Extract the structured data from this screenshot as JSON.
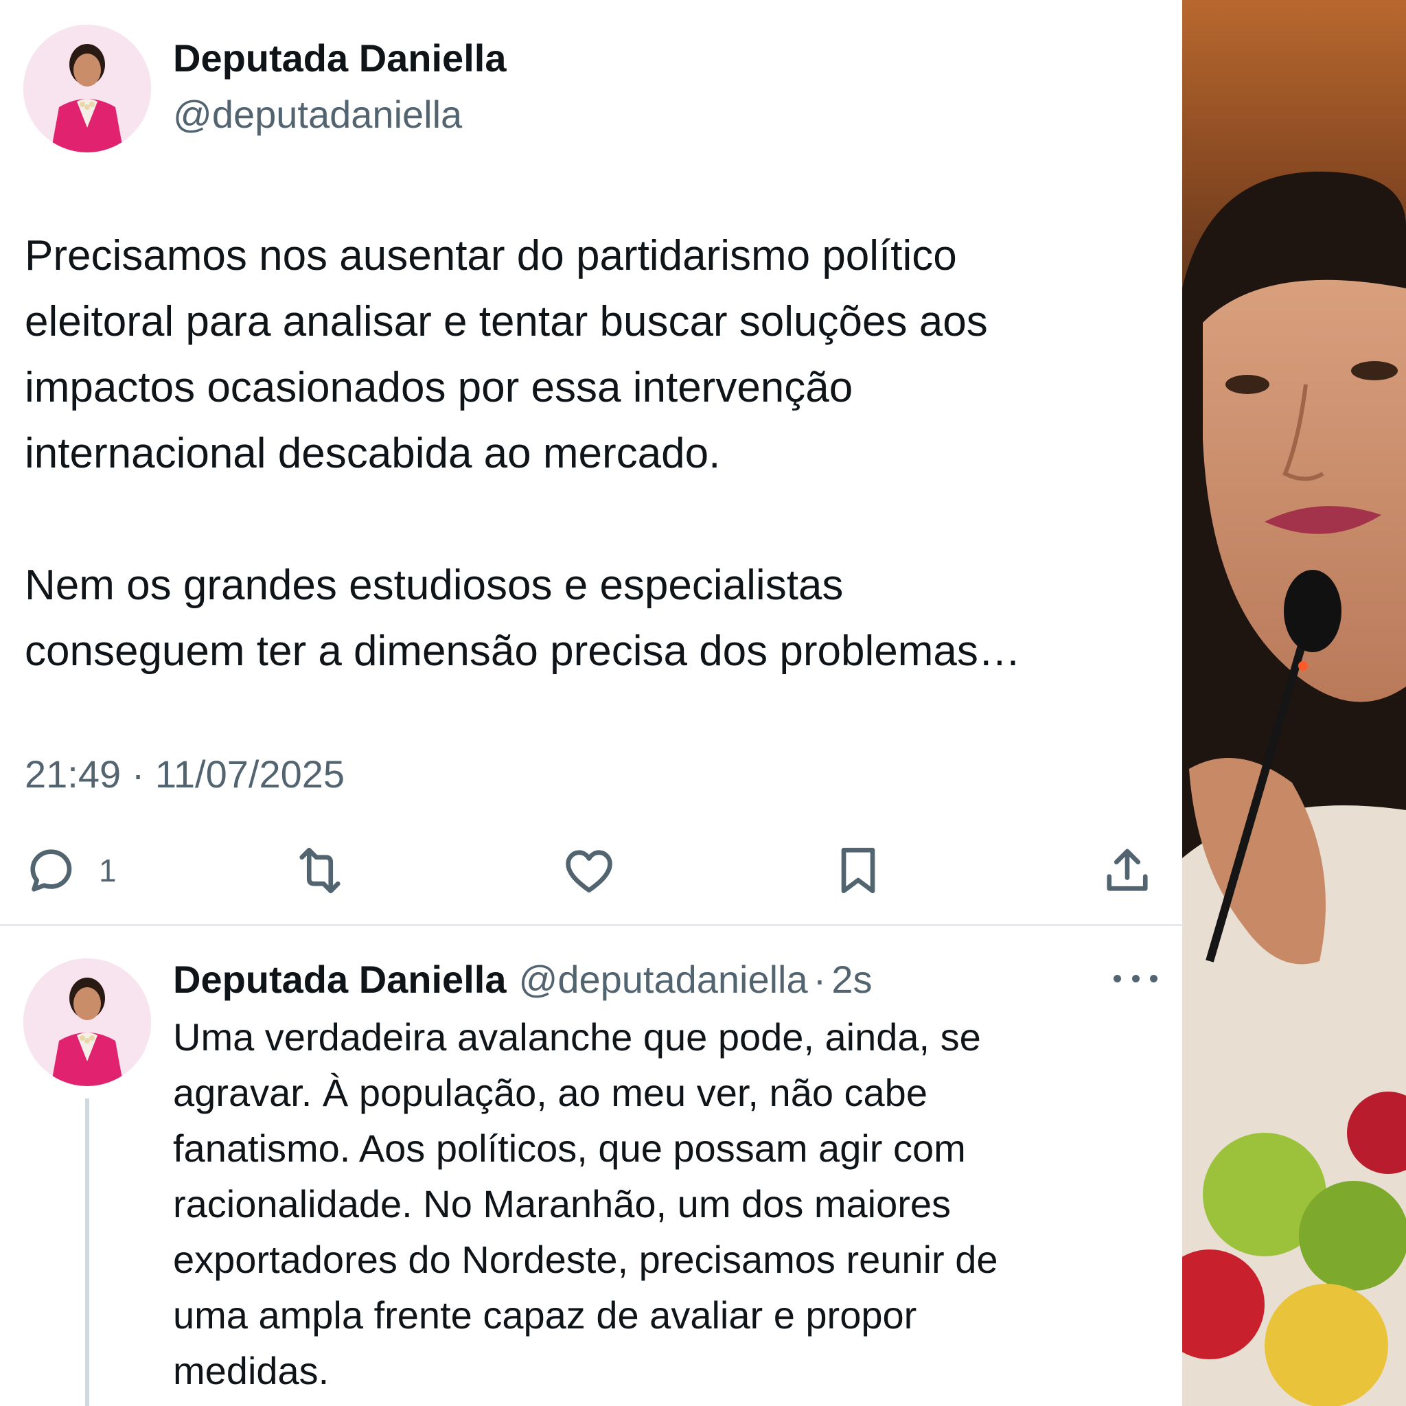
{
  "tweet": {
    "author_name": "Deputada Daniella",
    "author_handle": "@deputadaniella",
    "avatar_icon": "profile-avatar",
    "text_lines": [
      "Precisamos nos ausentar do partidarismo político",
      "eleitoral para analisar e tentar buscar soluções aos",
      "impactos ocasionados por essa intervenção",
      "internacional descabida ao mercado.",
      "Nem os grandes estudiosos e especialistas",
      "conseguem ter a dimensão precisa dos problemas…"
    ],
    "timestamp": "21:49 · 11/07/2025",
    "actions": {
      "reply_count": "1",
      "reply_icon": "speech-bubble-icon",
      "retweet_icon": "retweet-icon",
      "like_icon": "heart-icon",
      "bookmark_icon": "bookmark-icon",
      "share_icon": "share-upload-icon"
    }
  },
  "reply": {
    "author_name": "Deputada Daniella",
    "author_handle": "@deputadaniella",
    "separator": "·",
    "time_ago": "2s",
    "more_icon": "ellipsis-icon",
    "text_lines": [
      "Uma verdadeira avalanche que pode, ainda, se",
      "agravar. À população, ao meu ver, não cabe",
      "fanatismo. Aos políticos, que possam agir com",
      "racionalidade. No Maranhão, um dos maiores",
      "exportadores do Nordeste, precisamos reunir de",
      "uma ampla frente capaz de avaliar e propor",
      "medidas."
    ]
  },
  "colors": {
    "text_primary": "#0f1419",
    "text_secondary": "#536471",
    "divider": "#e7e9ee",
    "thread_line": "#cfd9de",
    "avatar_blazer": "#e0226f"
  },
  "side_photo": "photo of speaker at microphone"
}
